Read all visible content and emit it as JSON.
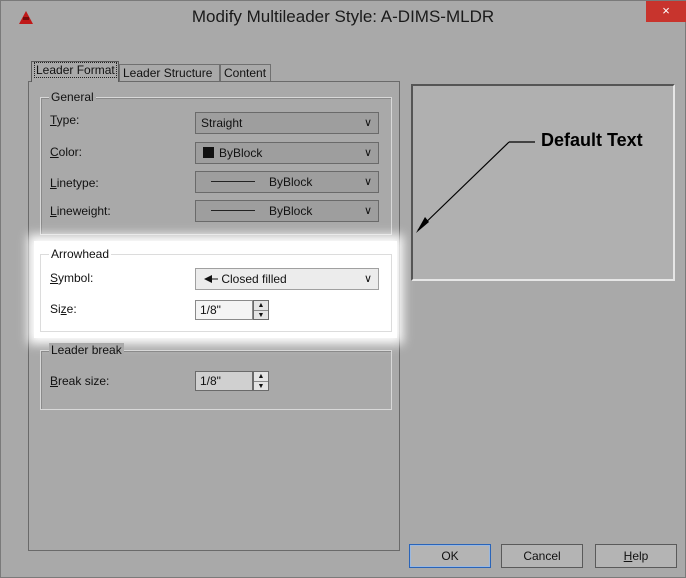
{
  "window": {
    "title": "Modify Multileader Style: A-DIMS-MLDR",
    "close_symbol": "×",
    "icon": "autocad-app-icon"
  },
  "tabs": [
    {
      "label": "Leader Format",
      "active": true
    },
    {
      "label": "Leader Structure",
      "active": false
    },
    {
      "label": "Content",
      "active": false
    }
  ],
  "general": {
    "title": "General",
    "type": {
      "label": "Type:",
      "value": "Straight"
    },
    "color": {
      "label": "Color:",
      "value": "ByBlock",
      "swatch": "#111111"
    },
    "linetype": {
      "label": "Linetype:",
      "value": "ByBlock"
    },
    "lineweight": {
      "label": "Lineweight:",
      "value": "ByBlock"
    }
  },
  "arrowhead": {
    "title": "Arrowhead",
    "symbol": {
      "label": "Symbol:",
      "value": "Closed filled"
    },
    "size": {
      "label": "Size:",
      "value": "1/8\""
    }
  },
  "leader_break": {
    "title": "Leader break",
    "break_size": {
      "label": "Break size:",
      "value": "1/8\""
    }
  },
  "preview": {
    "text": "Default Text"
  },
  "buttons": {
    "ok": "OK",
    "cancel": "Cancel",
    "help": "Help"
  },
  "icons": {
    "dropdown_arrow": "chevron-down-icon",
    "spin_up": "▲",
    "spin_down": "▼",
    "arrowhead_glyph": "closed-filled-arrow-icon"
  },
  "colors": {
    "dialog_bg": "#a9a9a9",
    "close_button": "#c8342d",
    "app_icon": "#c01818"
  }
}
